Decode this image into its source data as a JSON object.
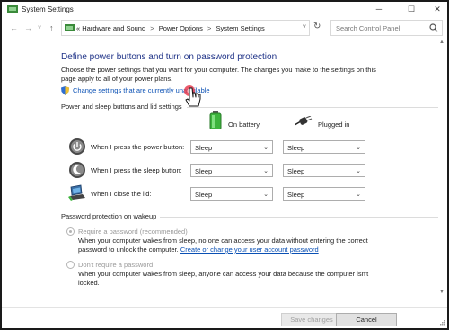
{
  "window": {
    "title": "System Settings",
    "minimize_icon": "─",
    "maximize_icon": "☐",
    "close_icon": "✕"
  },
  "nav": {
    "back_icon": "←",
    "forward_icon": "→",
    "recent_icon": "˅",
    "up_icon": "↑",
    "breadcrumb_prefix": "«",
    "breadcrumbs": [
      "Hardware and Sound",
      "Power Options",
      "System Settings"
    ],
    "separator": ">",
    "dropdown_icon": "˅",
    "refresh_icon": "↻",
    "search_placeholder": "Search Control Panel"
  },
  "page": {
    "heading": "Define power buttons and turn on password protection",
    "description": "Choose the power settings that you want for your computer. The changes you make to the settings on this page apply to all of your power plans.",
    "change_link": "Change settings that are currently unavailable"
  },
  "power_section": {
    "title": "Power and sleep buttons and lid settings",
    "col_battery": "On battery",
    "col_plugged": "Plugged in",
    "rows": [
      {
        "label": "When I press the power button:",
        "battery": "Sleep",
        "plugged": "Sleep"
      },
      {
        "label": "When I press the sleep button:",
        "battery": "Sleep",
        "plugged": "Sleep"
      },
      {
        "label": "When I close the lid:",
        "battery": "Sleep",
        "plugged": "Sleep"
      }
    ],
    "dropdown_arrow": "⌄"
  },
  "password_section": {
    "title": "Password protection on wakeup",
    "require_label": "Require a password (recommended)",
    "require_desc": "When your computer wakes from sleep, no one can access your data without entering the correct password to unlock the computer.",
    "require_link": "Create or change your user account password",
    "norequire_label": "Don't require a password",
    "norequire_desc": "When your computer wakes from sleep, anyone can access your data because the computer isn't locked."
  },
  "footer": {
    "save_label": "Save changes",
    "cancel_label": "Cancel"
  },
  "scrollbar": {
    "up_icon": "▲",
    "down_icon": "▼"
  },
  "colors": {
    "heading": "#1e3287",
    "link": "#0a50b4",
    "battery_green": "#3cb43c",
    "cursor_highlight": "#e63c50"
  }
}
